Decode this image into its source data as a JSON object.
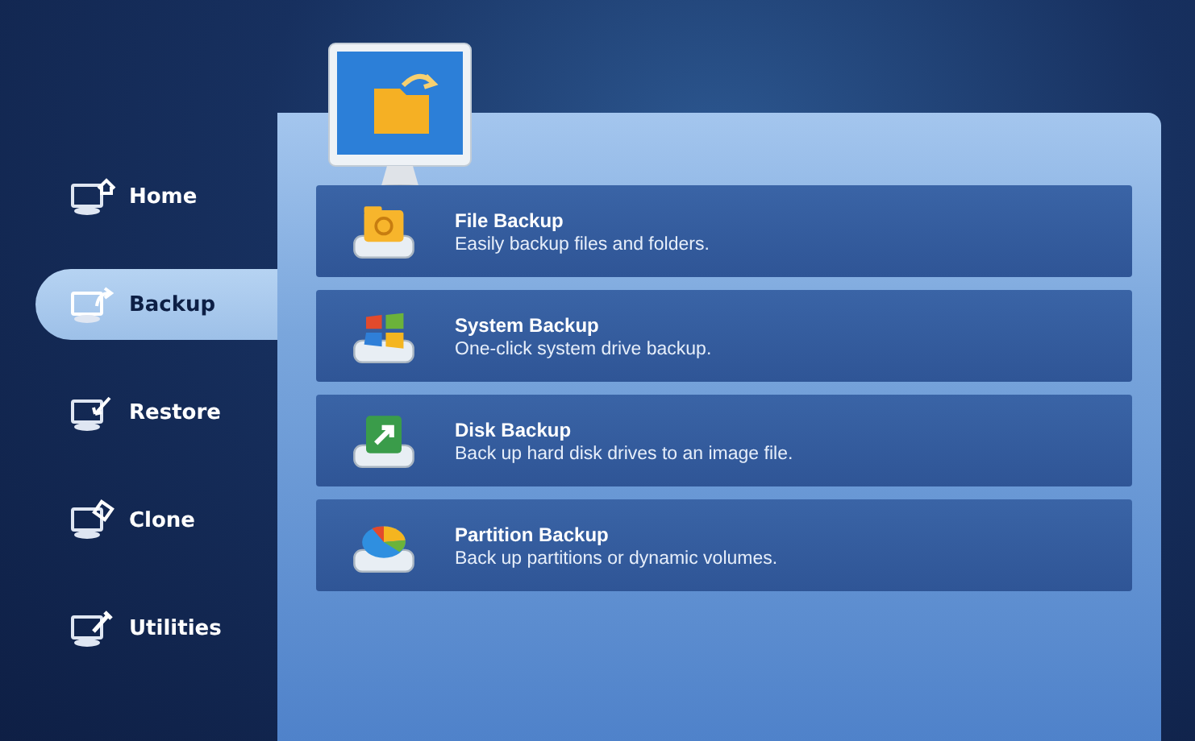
{
  "sidebar": {
    "items": [
      {
        "kind": "home",
        "label": "Home",
        "selected": false
      },
      {
        "kind": "backup",
        "label": "Backup",
        "selected": true
      },
      {
        "kind": "restore",
        "label": "Restore",
        "selected": false
      },
      {
        "kind": "clone",
        "label": "Clone",
        "selected": false
      },
      {
        "kind": "utilities",
        "label": "Utilities",
        "selected": false
      }
    ]
  },
  "options": [
    {
      "kind": "file",
      "title": "File Backup",
      "description": "Easily backup files and folders."
    },
    {
      "kind": "system",
      "title": "System Backup",
      "description": "One-click system drive backup."
    },
    {
      "kind": "disk",
      "title": "Disk Backup",
      "description": "Back up hard disk drives to an image file."
    },
    {
      "kind": "partition",
      "title": "Partition Backup",
      "description": "Back up partitions or dynamic volumes."
    }
  ]
}
